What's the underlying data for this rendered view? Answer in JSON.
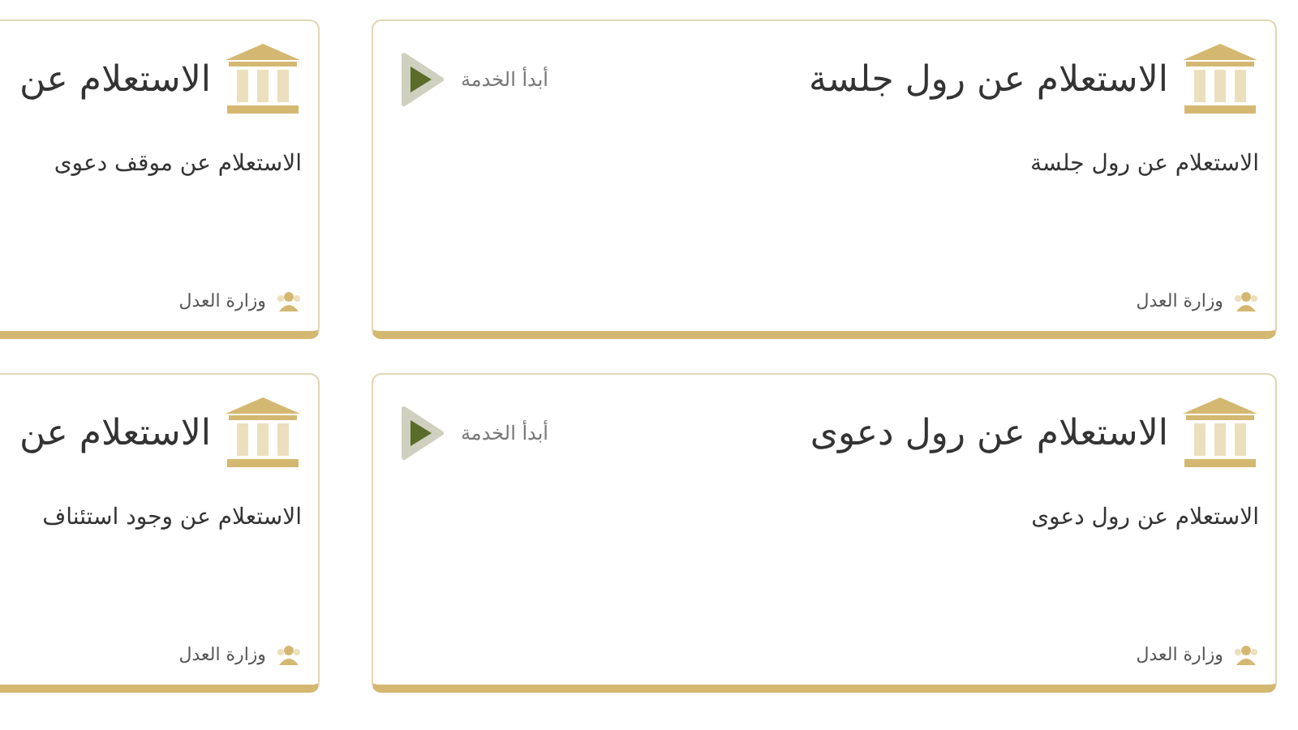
{
  "cards": [
    {
      "title": "الاستعلام عن رول جلسة",
      "description": "الاستعلام عن رول جلسة",
      "start_label": "أبدأ الخدمة",
      "agency": "وزارة العدل"
    },
    {
      "title": "الاستعلام عن",
      "description": "الاستعلام عن موقف دعوى",
      "agency": "وزارة العدل"
    },
    {
      "title": "الاستعلام عن رول دعوى",
      "description": "الاستعلام عن رول دعوى",
      "start_label": "أبدأ الخدمة",
      "agency": "وزارة العدل"
    },
    {
      "title": "الاستعلام عن",
      "description": "الاستعلام عن وجود استئناف",
      "agency": "وزارة العدل"
    }
  ]
}
